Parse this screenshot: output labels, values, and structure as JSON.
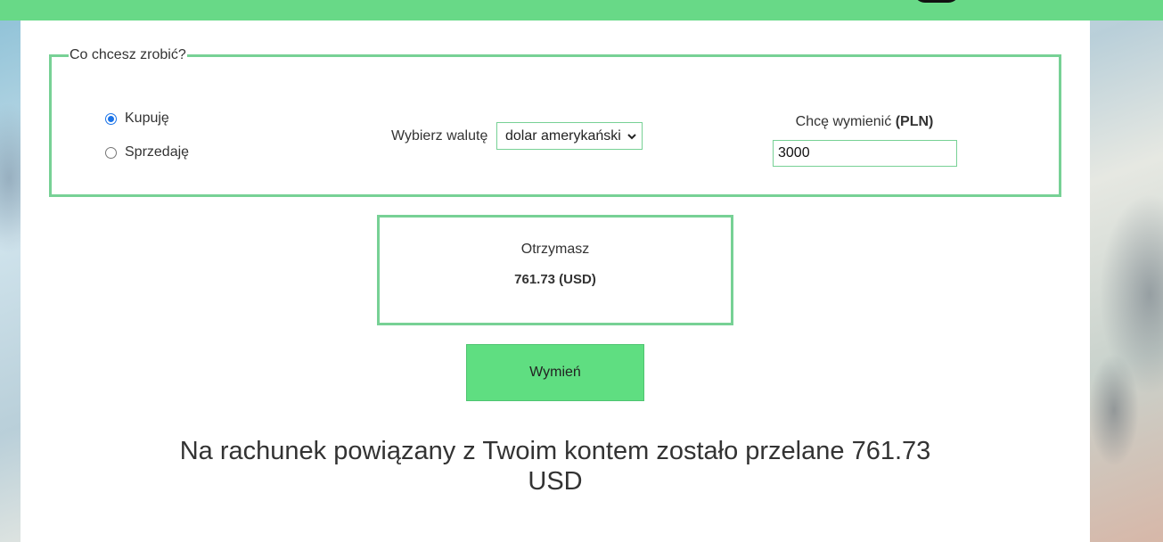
{
  "form": {
    "legend": "Co chcesz zrobić?",
    "options": [
      {
        "label": "Kupuję",
        "checked": true
      },
      {
        "label": "Sprzedaję",
        "checked": false
      }
    ],
    "currency_label": "Wybierz walutę",
    "currency_selected": "dolar amerykański",
    "amount_label_prefix": "Chcę wymienić",
    "amount_label_unit": "(PLN)",
    "amount_value": "3000"
  },
  "result": {
    "title": "Otrzymasz",
    "value": "761.73 (USD)"
  },
  "exchange_button": "Wymień",
  "message": "Na rachunek powiązany z Twoim kontem zostało przelane 761.73 USD",
  "colors": {
    "accent": "#68d987",
    "border": "#77d195",
    "button": "#5fde81"
  },
  "icons": {
    "select_arrow": "chevron-down-icon"
  }
}
